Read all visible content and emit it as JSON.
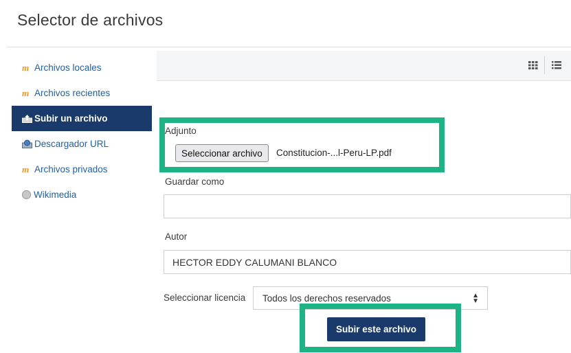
{
  "dialog": {
    "title": "Selector de archivos"
  },
  "sidebar": {
    "items": [
      {
        "label": "Archivos locales",
        "icon": "moodle-icon"
      },
      {
        "label": "Archivos recientes",
        "icon": "moodle-icon"
      },
      {
        "label": "Subir un archivo",
        "icon": "upload-icon",
        "active": true
      },
      {
        "label": "Descargador URL",
        "icon": "url-downloader-icon"
      },
      {
        "label": "Archivos privados",
        "icon": "moodle-icon"
      },
      {
        "label": "Wikimedia",
        "icon": "wikimedia-globe-icon"
      }
    ]
  },
  "toolbar": {
    "icons": [
      "grid-view-icon",
      "list-view-icon"
    ]
  },
  "form": {
    "attachment_label": "Adjunto",
    "choose_file_button": "Seleccionar archivo",
    "selected_file": "Constitucion-...l-Peru-LP.pdf",
    "save_as_label": "Guardar como",
    "save_as_value": "",
    "author_label": "Autor",
    "author_value": "HECTOR EDDY CALUMANI BLANCO",
    "license_label": "Seleccionar licencia",
    "license_value": "Todos los derechos reservados",
    "submit_button": "Subir este archivo"
  },
  "colors": {
    "highlight": "#1db385",
    "primary": "#1a3a6b",
    "link": "#1f5fa8",
    "moodle_orange": "#f7931e"
  }
}
